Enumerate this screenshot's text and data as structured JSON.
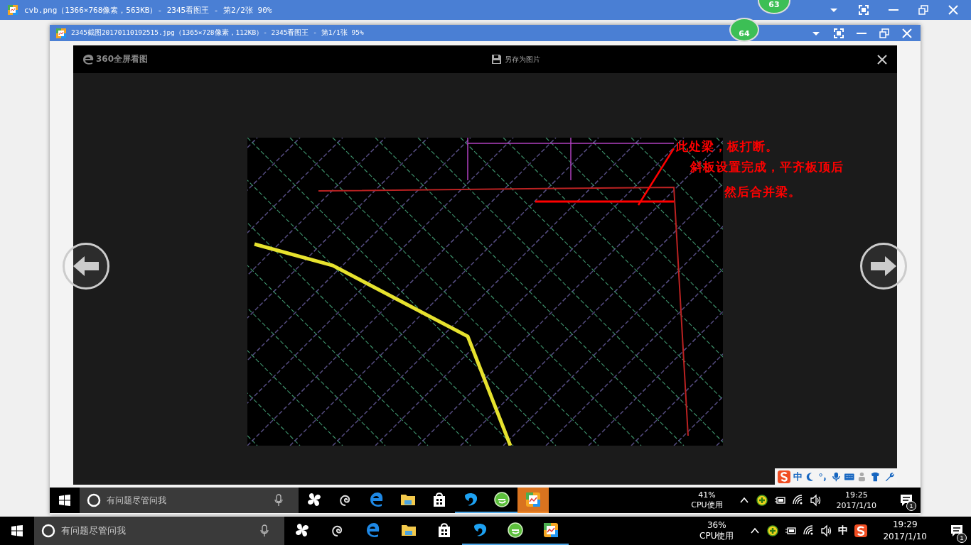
{
  "outer_window": {
    "title": "cvb.png（1366×768像素，563KB）- 2345看图王 - 第2/2张 90%",
    "badge": "63"
  },
  "inner_window": {
    "title": "2345截图20170110192515.jpg（1365×728像素，112KB）- 2345看图王 - 第1/1张 95%",
    "badge": "64"
  },
  "viewer": {
    "logo": "360全屏看图",
    "save_button": "另存为图片",
    "annotations": [
      "此处梁，板打断。",
      "斜板设置完成，平齐板顶后",
      "然后合并梁。"
    ],
    "ime_toolbar": {
      "mode": "中"
    }
  },
  "inner_taskbar": {
    "search_placeholder": "有问题尽管问我",
    "apps": [
      {
        "kind": "pinwheel",
        "running": false,
        "selected": false
      },
      {
        "kind": "swirl",
        "running": false,
        "selected": false
      },
      {
        "kind": "edge",
        "running": false,
        "selected": false
      },
      {
        "kind": "folder",
        "running": false,
        "selected": false
      },
      {
        "kind": "store",
        "running": false,
        "selected": false
      },
      {
        "kind": "bird",
        "running": true,
        "selected": false
      },
      {
        "kind": "globe",
        "running": true,
        "selected": false
      },
      {
        "kind": "viewer",
        "running": true,
        "selected": true
      }
    ],
    "cpu": "41%",
    "cpu_label": "CPU使用",
    "time": "19:25",
    "date": "2017/1/10",
    "notifications": "1"
  },
  "taskbar": {
    "search_placeholder": "有问题尽管问我",
    "apps": [
      {
        "kind": "pinwheel",
        "running": false,
        "selected": false
      },
      {
        "kind": "swirl",
        "running": false,
        "selected": false
      },
      {
        "kind": "edge",
        "running": false,
        "selected": false
      },
      {
        "kind": "folder",
        "running": false,
        "selected": false
      },
      {
        "kind": "store",
        "running": false,
        "selected": false
      },
      {
        "kind": "bird",
        "running": true,
        "selected": false
      },
      {
        "kind": "globe",
        "running": true,
        "selected": false
      },
      {
        "kind": "viewer",
        "running": true,
        "selected": false
      }
    ],
    "cpu": "36%",
    "cpu_label": "CPU使用",
    "ime": "中",
    "time": "19:29",
    "date": "2017/1/10",
    "notifications": "1"
  }
}
